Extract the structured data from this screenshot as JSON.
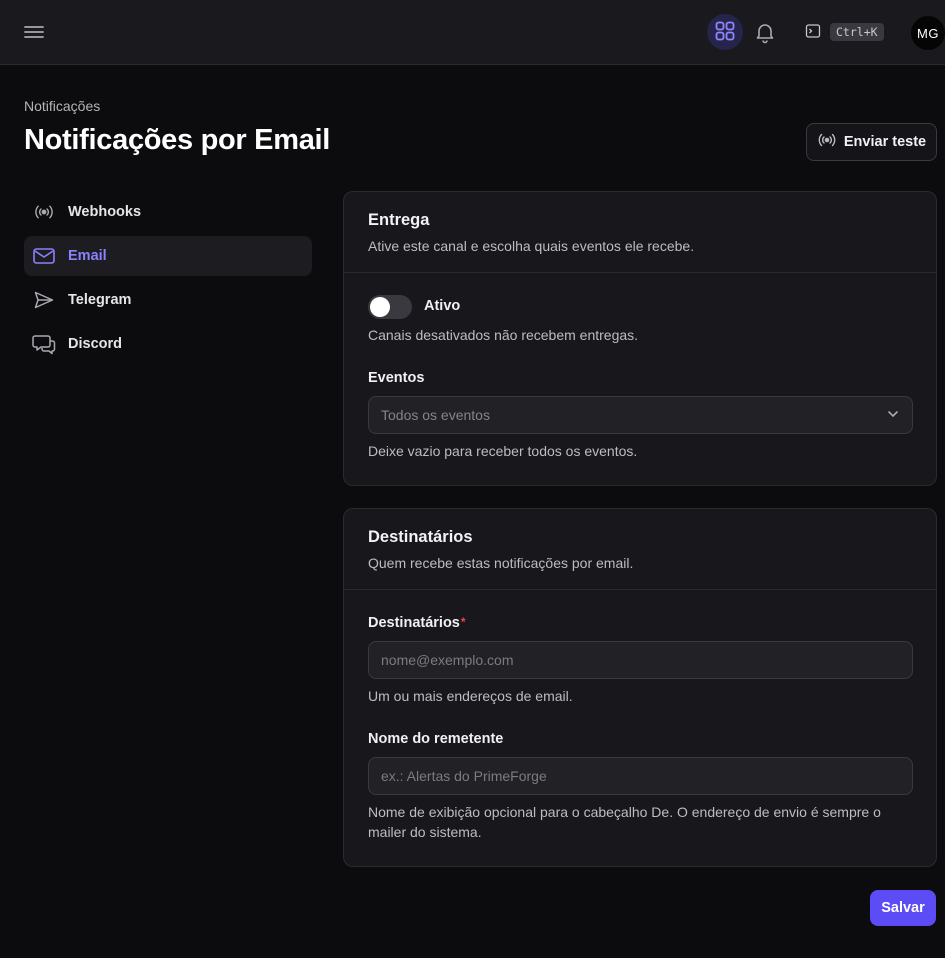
{
  "topbar": {
    "shortcut": "Ctrl+K",
    "avatar_initials": "MG",
    "accent": "#5b4cf5"
  },
  "header": {
    "breadcrumb": "Notificações",
    "title": "Notificações por Email",
    "test_button": "Enviar teste"
  },
  "sidebar": {
    "items": [
      {
        "label": "Webhooks",
        "icon": "broadcast-icon"
      },
      {
        "label": "Email",
        "icon": "mail-icon",
        "active": true
      },
      {
        "label": "Telegram",
        "icon": "send-icon"
      },
      {
        "label": "Discord",
        "icon": "chat-icon"
      }
    ]
  },
  "delivery": {
    "title": "Entrega",
    "subtitle": "Ative este canal e escolha quais eventos ele recebe.",
    "toggle_label": "Ativo",
    "toggle_on": false,
    "toggle_help": "Canais desativados não recebem entregas.",
    "events_label": "Eventos",
    "events_placeholder": "Todos os eventos",
    "events_help": "Deixe vazio para receber todos os eventos."
  },
  "recipients": {
    "title": "Destinatários",
    "subtitle": "Quem recebe estas notificações por email.",
    "field_label": "Destinatários",
    "required_mark": "*",
    "field_placeholder": "nome@exemplo.com",
    "field_help": "Um ou mais endereços de email.",
    "sender_label": "Nome do remetente",
    "sender_placeholder": "ex.: Alertas do PrimeForge",
    "sender_help": "Nome de exibição opcional para o cabeçalho De. O endereço de envio é sempre o mailer do sistema."
  },
  "footer": {
    "save_button": "Salvar"
  }
}
